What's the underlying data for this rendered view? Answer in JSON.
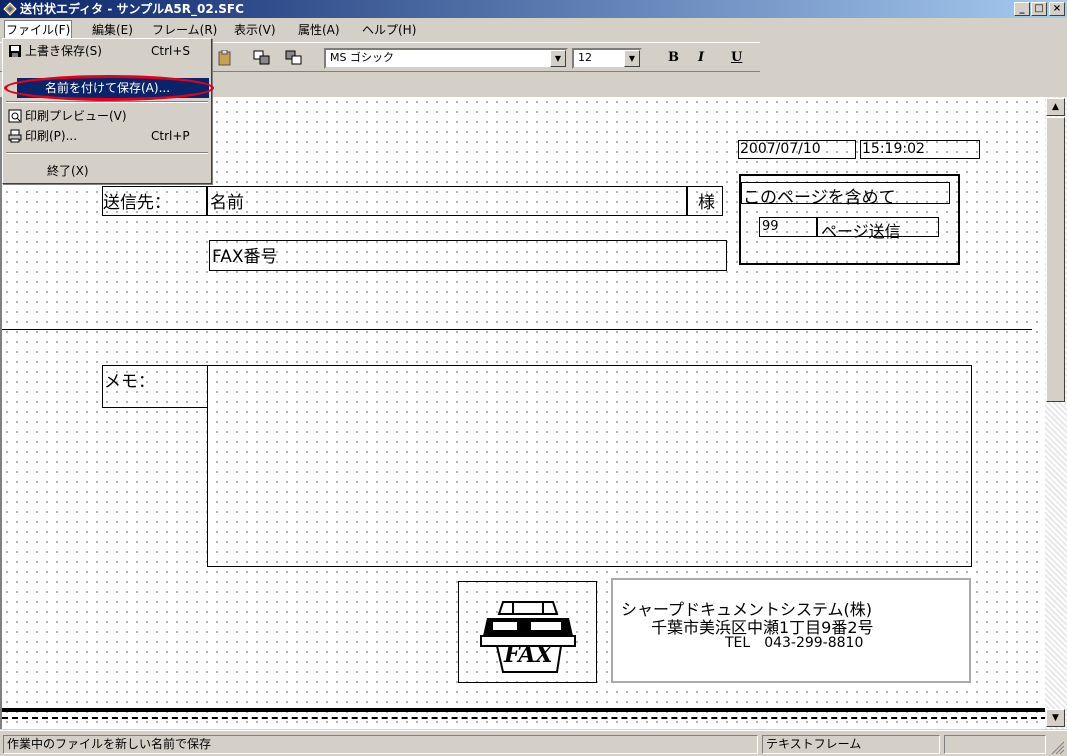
{
  "window": {
    "title": "送付状エディタ - サンプルA5R_02.SFC",
    "controls": {
      "minimize": "_",
      "maximize": "□",
      "close": "×"
    }
  },
  "menu": [
    "ファイル(F)",
    "編集(E)",
    "フレーム(R)",
    "表示(V)",
    "属性(A)",
    "ヘルプ(H)"
  ],
  "file_menu": [
    {
      "label": "上書き保存(S)",
      "shortcut": "Ctrl+S",
      "icon": "floppy-disk-icon"
    },
    {
      "label": "名前を付けて保存(A)...",
      "shortcut": "",
      "highlighted": true
    },
    {
      "label": "印刷プレビュー(V)",
      "shortcut": "",
      "icon": "print-preview-icon"
    },
    {
      "label": "印刷(P)...",
      "shortcut": "Ctrl+P",
      "icon": "printer-icon"
    },
    {
      "label": "終了(X)",
      "shortcut": ""
    }
  ],
  "toolbar": {
    "font_name": "MS ゴシック",
    "font_size": "12",
    "bold": "B",
    "italic": "I",
    "underline": "U",
    "dropdown_arrow": "▼"
  },
  "document": {
    "date": "2007/07/10",
    "time": "15:19:02",
    "to_label": "送信先：",
    "name_label": "名前",
    "honorific": "様",
    "fax_label": "FAX番号",
    "pages_caption": "このページを含めて",
    "pages_count": "99",
    "pages_suffix": "ページ送信",
    "memo_label": "メモ：",
    "fax_logo_text": "FAX",
    "company_name": "シャープドキュメントシステム(株)",
    "company_address": "千葉市美浜区中瀬1丁目9番2号",
    "company_tel": "TEL　043-299-8810"
  },
  "scrollbar": {
    "up_arrow": "▲",
    "down_arrow": "▼"
  },
  "status": {
    "message": "作業中のファイルを新しい名前で保存",
    "frame_type": "テキストフレーム"
  },
  "colors": {
    "title_bar": "#0a246a",
    "menu_highlight": "#0a246a",
    "annotation": "#e2001a",
    "chrome": "#d4d0c8"
  }
}
